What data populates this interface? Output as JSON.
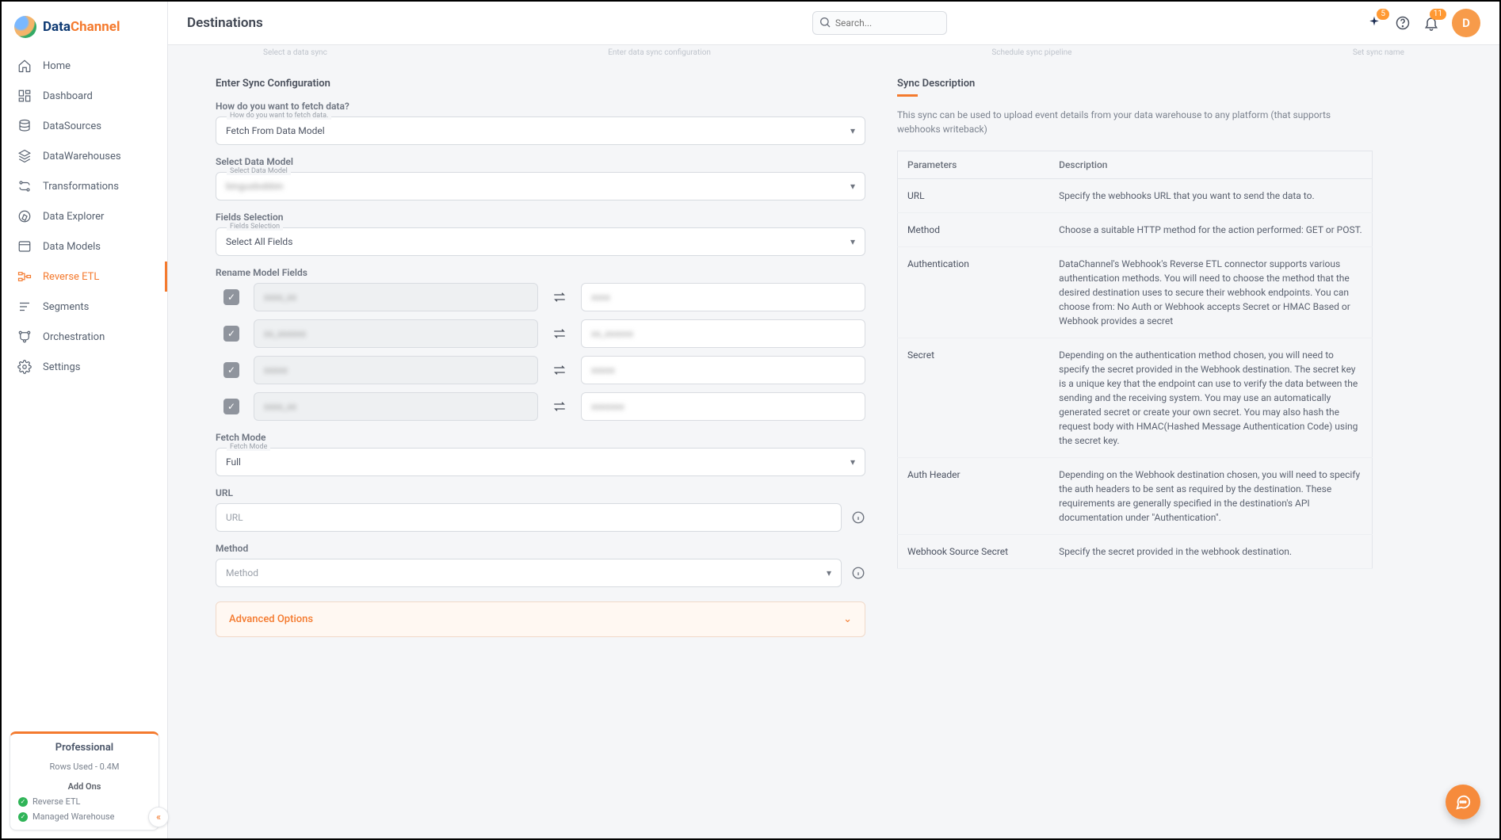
{
  "brand": {
    "name_a": "Data",
    "name_b": "Channel"
  },
  "page_title": "Destinations",
  "search": {
    "placeholder": "Search..."
  },
  "badges": {
    "sparkle": "5",
    "bell": "11"
  },
  "avatar_initial": "D",
  "sidebar": {
    "items": [
      {
        "label": "Home"
      },
      {
        "label": "Dashboard"
      },
      {
        "label": "DataSources"
      },
      {
        "label": "DataWarehouses"
      },
      {
        "label": "Transformations"
      },
      {
        "label": "Data Explorer"
      },
      {
        "label": "Data Models"
      },
      {
        "label": "Reverse ETL"
      },
      {
        "label": "Segments"
      },
      {
        "label": "Orchestration"
      },
      {
        "label": "Settings"
      }
    ],
    "plan": {
      "title": "Professional",
      "rows": "Rows Used - 0.4M",
      "addons_title": "Add Ons",
      "addon1": "Reverse ETL",
      "addon2": "Managed Warehouse"
    }
  },
  "wizard_steps": [
    "Select a data sync",
    "Enter data sync configuration",
    "Schedule sync pipeline",
    "Set sync name"
  ],
  "config": {
    "section_title": "Enter Sync Configuration",
    "fetch_q": "How do you want to fetch data?",
    "fetch_label": "How do you want to fetch data.",
    "fetch_value": "Fetch From Data Model",
    "model_q": "Select Data Model",
    "model_label": "Select Data Model",
    "model_value": "bingusbobbin",
    "fields_q": "Fields Selection",
    "fields_label": "Fields Selection",
    "fields_value": "Select All Fields",
    "rename_q": "Rename Model Fields",
    "rows": [
      {
        "src": "xxxx_xx",
        "dst": "xxxx"
      },
      {
        "src": "xx_xxxxxx",
        "dst": "xx_xxxxxx"
      },
      {
        "src": "xxxxx",
        "dst": "xxxxx"
      },
      {
        "src": "xxxx_xx",
        "dst": "xxxxxxx"
      }
    ],
    "fetchmode_q": "Fetch Mode",
    "fetchmode_label": "Fetch Mode",
    "fetchmode_value": "Full",
    "url_q": "URL",
    "url_placeholder": "URL",
    "method_q": "Method",
    "method_placeholder": "Method",
    "advanced": "Advanced Options"
  },
  "desc": {
    "title": "Sync Description",
    "text": "This sync can be used to upload event details from your data warehouse to any platform (that supports webhooks writeback)",
    "th1": "Parameters",
    "th2": "Description",
    "rows": [
      {
        "p": "URL",
        "d": "Specify the webhooks URL that you want to send the data to."
      },
      {
        "p": "Method",
        "d": "Choose a suitable HTTP method for the action performed: GET or POST."
      },
      {
        "p": "Authentication",
        "d": "DataChannel's Webhook's Reverse ETL connector supports various authentication methods. You will need to choose the method that the desired destination uses to secure their webhook endpoints. You can choose from: No Auth or Webhook accepts Secret or HMAC Based or Webhook provides a secret"
      },
      {
        "p": "Secret",
        "d": "Depending on the authentication method chosen, you will need to specify the secret provided in the Webhook destination. The secret key is a unique key that the endpoint can use to verify the data between the sending and the receiving system. You may use an automatically generated secret or create your own secret. You may also hash the request body with HMAC(Hashed Message Authentication Code) using the secret key."
      },
      {
        "p": "Auth Header",
        "d": "Depending on the Webhook destination chosen, you will need to specify the auth headers to be sent as required by the destination. These requirements are generally specified in the destination's API documentation under \"Authentication\"."
      },
      {
        "p": "Webhook Source Secret",
        "d": "Specify the secret provided in the webhook destination."
      }
    ]
  }
}
